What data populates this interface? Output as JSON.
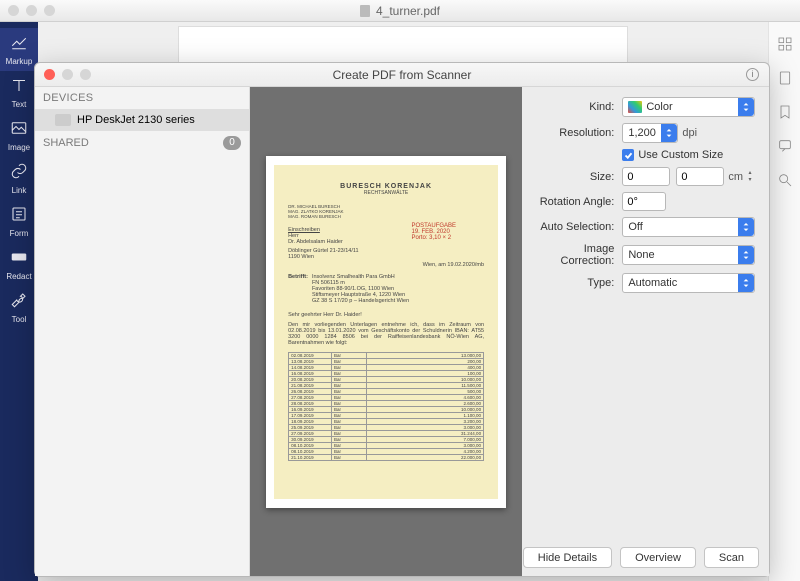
{
  "window": {
    "title": "4_turner.pdf"
  },
  "sidebar": {
    "items": [
      {
        "label": "Markup"
      },
      {
        "label": "Text"
      },
      {
        "label": "Image"
      },
      {
        "label": "Link"
      },
      {
        "label": "Form"
      },
      {
        "label": "Redact"
      },
      {
        "label": "Tool"
      }
    ]
  },
  "modal": {
    "title": "Create PDF from Scanner",
    "devices_header": "DEVICES",
    "device_name": "HP DeskJet 2130 series",
    "shared_header": "SHARED",
    "shared_count": "0",
    "settings": {
      "kind_label": "Kind:",
      "kind_value": "Color",
      "resolution_label": "Resolution:",
      "resolution_value": "1,200",
      "resolution_unit": "dpi",
      "use_custom_size_label": "Use Custom Size",
      "size_label": "Size:",
      "size_w": "0",
      "size_h": "0",
      "size_unit": "cm",
      "rotation_label": "Rotation Angle:",
      "rotation_value": "0°",
      "auto_selection_label": "Auto Selection:",
      "auto_selection_value": "Off",
      "image_correction_label": "Image Correction:",
      "image_correction_value": "None",
      "type_label": "Type:",
      "type_value": "Automatic"
    },
    "buttons": {
      "hide_details": "Hide Details",
      "overview": "Overview",
      "scan": "Scan"
    }
  },
  "scan_preview": {
    "firm": "BURESCH   KORENJAK",
    "subtitle": "RECHTSANWÄLTE",
    "stamp_lines": [
      "POSTAUFGABE",
      "19. FEB. 2020",
      "Porto:  3,10 × 2"
    ],
    "addr_block": "DR. MICHAEL BURESCH\nMAG. ZLATKO KORENJAK\nMAG. ROMAN BURESCH",
    "einschreiben": "Einschreiben",
    "recipient": "Herr\nDr. Abdelsalam Haider",
    "recipient_addr": "Döblinger Gürtel 21-23/14/11\n1190 Wien",
    "date_city": "Wien, am 19.02.2020/mb",
    "betrifft_label": "Betrifft:",
    "betrifft": "Insolvenz Smalhealth Para GmbH\nFN 506115 m\nFavoriten 88-90/1.OG, 1100 Wien\nStiftsmeyer Hauptstraße 4, 1220 Wien\nGZ 38 S 17/20 p – Handelsgericht Wien",
    "salutation": "Sehr geehrter Herr Dr. Haider!",
    "body": "Den mir vorliegenden Unterlagen entnehme ich, dass im Zeitraum von 02.08.2019 bis 13.01.2020 vom Geschäftskonto der Schuldnerin IBAN: AT55 3200 0000 1284 8506 bei der Raiffeisenlandesbank NÖ-Wien AG, Barentnahmen wie folgt:",
    "table": [
      [
        "02.08.2019",
        "Bar",
        "13.000,00"
      ],
      [
        "13.08.2019",
        "Bar",
        "200,00"
      ],
      [
        "14.08.2019",
        "Bar",
        "400,00"
      ],
      [
        "16.08.2019",
        "Bar",
        "100,00"
      ],
      [
        "20.08.2019",
        "Bar",
        "10.000,00"
      ],
      [
        "21.08.2019",
        "Bar",
        "11.500,00"
      ],
      [
        "26.08.2019",
        "Bar",
        "500,00"
      ],
      [
        "27.08.2019",
        "Bar",
        "4.600,00"
      ],
      [
        "28.08.2019",
        "Bar",
        "2.600,00"
      ],
      [
        "16.09.2019",
        "Bar",
        "10.000,00"
      ],
      [
        "17.09.2019",
        "Bar",
        "1.100,00"
      ],
      [
        "18.09.2019",
        "Bar",
        "3.200,00"
      ],
      [
        "25.09.2019",
        "Bar",
        "3.000,00"
      ],
      [
        "27.09.2019",
        "Bar",
        "31.244,00"
      ],
      [
        "30.09.2019",
        "Bar",
        "7.000,00"
      ],
      [
        "08.10.2019",
        "Bar",
        "3.000,00"
      ],
      [
        "08.10.2019",
        "Bar",
        "4.200,00"
      ],
      [
        "21.10.2019",
        "Bar",
        "22.000,00"
      ]
    ]
  }
}
